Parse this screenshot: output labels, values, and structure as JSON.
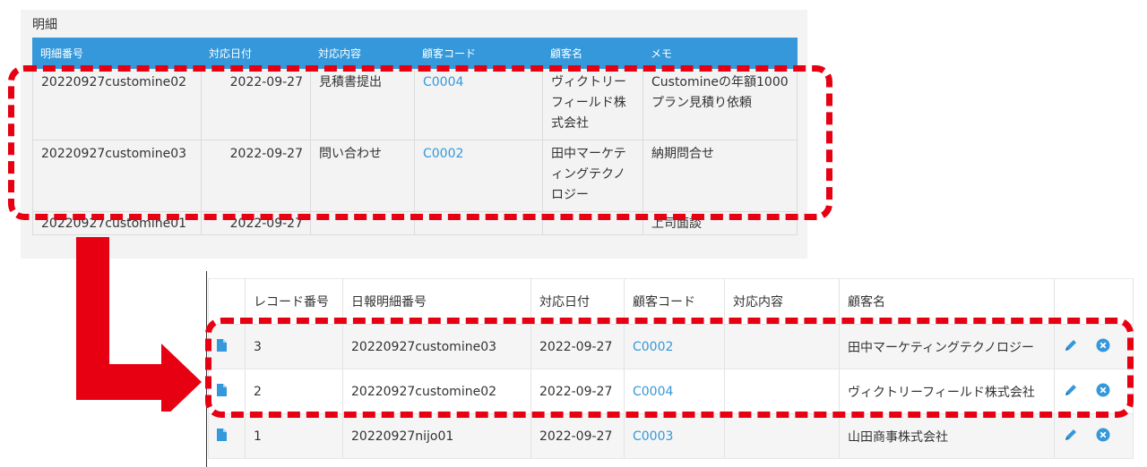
{
  "detail": {
    "title": "明細",
    "headers": [
      "明細番号",
      "対応日付",
      "対応内容",
      "顧客コード",
      "顧客名",
      "メモ"
    ],
    "rows": [
      {
        "no": "20220927customine02",
        "date": "2022-09-27",
        "content": "見積書提出",
        "code": "C0004",
        "name": "ヴィクトリーフィールド株式会社",
        "memo": "Customineの年額1000プラン見積り依頼"
      },
      {
        "no": "20220927customine03",
        "date": "2022-09-27",
        "content": "問い合わせ",
        "code": "C0002",
        "name": "田中マーケティングテクノロジー",
        "memo": "納期問合せ"
      },
      {
        "no": "20220927customine01",
        "date": "2022-09-27",
        "content": "",
        "code": "",
        "name": "",
        "memo": "上司面談"
      }
    ]
  },
  "list": {
    "headers": [
      "",
      "レコード番号",
      "日報明細番号",
      "対応日付",
      "顧客コード",
      "対応内容",
      "顧客名",
      ""
    ],
    "rows": [
      {
        "record": "3",
        "detail_no": "20220927customine03",
        "date": "2022-09-27",
        "code": "C0002",
        "content": "",
        "name": "田中マーケティングテクノロジー"
      },
      {
        "record": "2",
        "detail_no": "20220927customine02",
        "date": "2022-09-27",
        "code": "C0004",
        "content": "",
        "name": "ヴィクトリーフィールド株式会社"
      },
      {
        "record": "1",
        "detail_no": "20220927nijo01",
        "date": "2022-09-27",
        "code": "C0003",
        "content": "",
        "name": "山田商事株式会社"
      }
    ],
    "row_icons": {
      "view": "document-icon",
      "edit": "pencil-icon",
      "delete": "close-circle-icon"
    }
  },
  "colors": {
    "accent": "#3498db",
    "annotation": "#e60012"
  }
}
